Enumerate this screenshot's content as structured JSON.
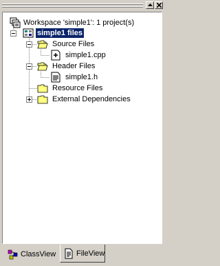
{
  "window": {
    "buttons": [
      "restore-icon",
      "close-icon"
    ]
  },
  "tree": {
    "workspace": {
      "label": "Workspace 'simple1': 1 project(s)",
      "icon": "workspace-icon"
    },
    "project": {
      "label": "simple1 files",
      "icon": "project-icon",
      "selected": true,
      "expanded": true
    },
    "folders": [
      {
        "label": "Source Files",
        "icon": "folder-open-icon",
        "expanded": true,
        "files": [
          {
            "label": "simple1.cpp",
            "icon": "cpp-file-icon"
          }
        ]
      },
      {
        "label": "Header Files",
        "icon": "folder-open-icon",
        "expanded": true,
        "files": [
          {
            "label": "simple1.h",
            "icon": "header-file-icon"
          }
        ]
      },
      {
        "label": "Resource Files",
        "icon": "folder-icon",
        "expanded": false,
        "files": []
      },
      {
        "label": "External Dependencies",
        "icon": "folder-icon",
        "expanded": false,
        "collapsed_with_children": true,
        "files": []
      }
    ]
  },
  "tabs": [
    {
      "label": "ClassView",
      "icon": "classview-icon",
      "active": false
    },
    {
      "label": "FileView",
      "icon": "fileview-icon",
      "active": true
    }
  ],
  "colors": {
    "selection": "#0a246a",
    "chrome": "#d4d0c8",
    "folder": "#ffff80"
  }
}
